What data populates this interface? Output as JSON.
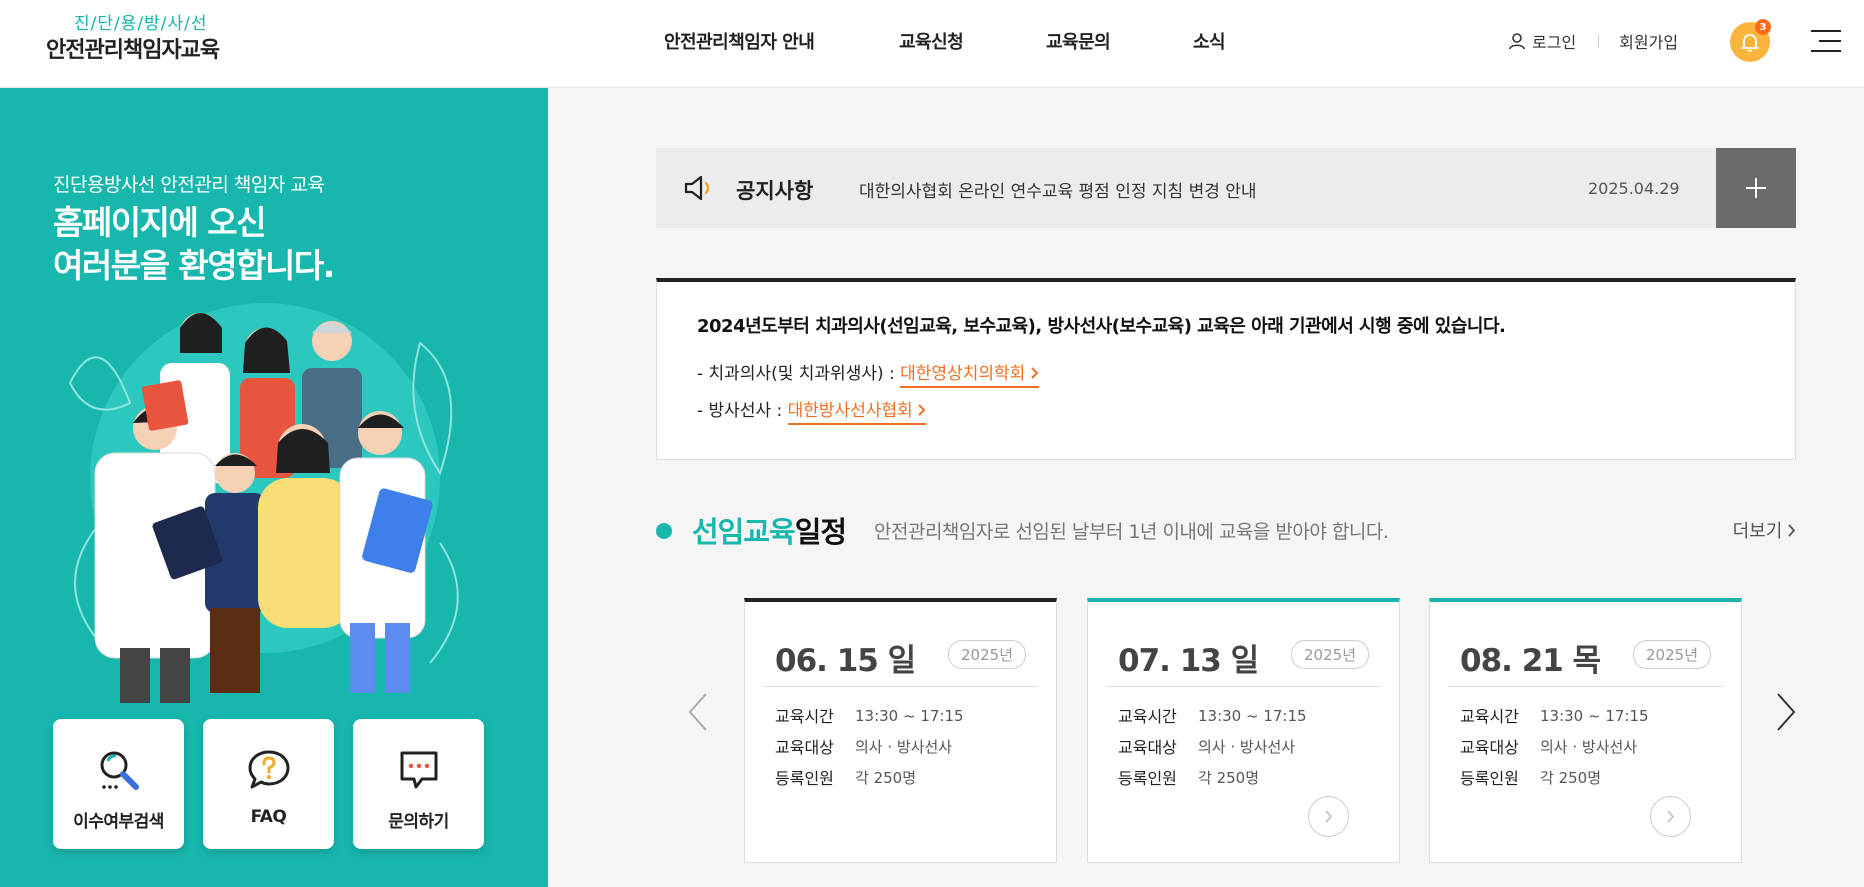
{
  "header": {
    "logo_sub": "진/단/용/방/사/선",
    "logo_main": "안전관리책임자교육",
    "nav": [
      "안전관리책임자 안내",
      "교육신청",
      "교육문의",
      "소식"
    ],
    "login_label": "로그인",
    "join_label": "회원가입",
    "notification_count": "3"
  },
  "hero": {
    "subtitle": "진단용방사선 안전관리 책임자 교육",
    "title_line1": "홈페이지에 오신",
    "title_line2": "여러분을 환영합니다.",
    "quick_links": [
      "이수여부검색",
      "FAQ",
      "문의하기"
    ]
  },
  "notice": {
    "title": "공지사항",
    "text": "대한의사협회 온라인 연수교육 평점 인정 지침 변경 안내",
    "date": "2025.04.29"
  },
  "info": {
    "heading": "2024년도부터 치과의사(선임교육, 보수교육), 방사선사(보수교육) 교육은 아래 기관에서 시행 중에 있습니다.",
    "line1_prefix": "- 치과의사(및 치과위생사) : ",
    "line1_link": "대한영상치의학회",
    "line2_prefix": "- 방사선사 : ",
    "line2_link": "대한방사선사협회"
  },
  "schedule": {
    "title_colored": "선임교육",
    "title_dark": "일정",
    "desc": "안전관리책임자로 선임된 날부터 1년 이내에 교육을 받아야 합니다.",
    "more_label": "더보기",
    "labels": {
      "time": "교육시간",
      "target": "교육대상",
      "capacity": "등록인원"
    },
    "cards": [
      {
        "date": "06. 15 일",
        "year": "2025년",
        "time": "13:30 ~ 17:15",
        "target": "의사 · 방사선사",
        "capacity": "각 250명"
      },
      {
        "date": "07. 13 일",
        "year": "2025년",
        "time": "13:30 ~ 17:15",
        "target": "의사 · 방사선사",
        "capacity": "각 250명"
      },
      {
        "date": "08. 21 목",
        "year": "2025년",
        "time": "13:30 ~ 17:15",
        "target": "의사 · 방사선사",
        "capacity": "각 250명"
      }
    ]
  },
  "colors": {
    "accent": "#17b7ae",
    "link": "#f07022",
    "bell": "#fbb53c"
  }
}
